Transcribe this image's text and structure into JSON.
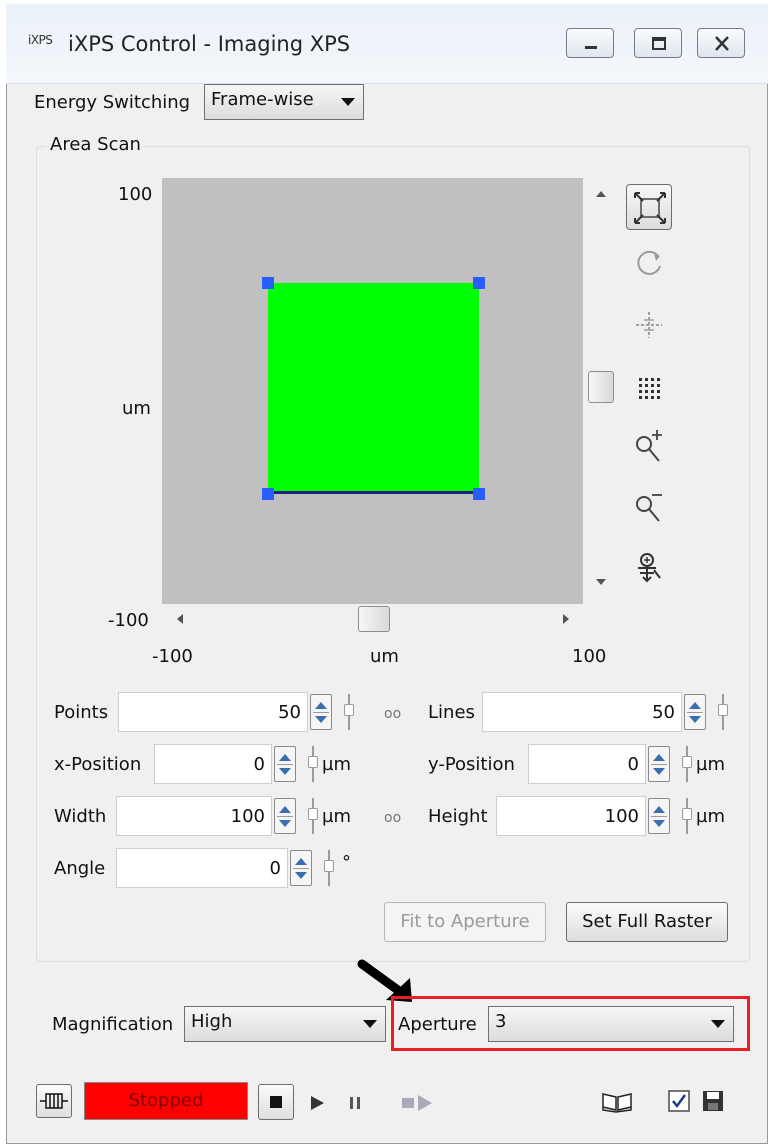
{
  "window": {
    "app_icon_text": "iXPS",
    "title": "iXPS Control - Imaging XPS",
    "controls": [
      "minimize-icon",
      "maximize-icon",
      "close-icon"
    ]
  },
  "energy_switching": {
    "label": "Energy Switching",
    "value": "Frame-wise"
  },
  "area_scan": {
    "group_label": "Area Scan",
    "plot": {
      "y_max": "100",
      "y_unit": "um",
      "y_min": "-100",
      "x_min": "-100",
      "x_unit": "um",
      "x_max": "100",
      "background_color": "#c0c0c0",
      "scan_area_color": "#00ff00",
      "handle_color": "#2b5cff"
    },
    "tools": [
      "fit-view-icon",
      "rotate-icon",
      "center-crosshair-icon",
      "grid-points-icon",
      "zoom-in-icon",
      "zoom-out-icon",
      "zoom-select-icon"
    ],
    "fields": {
      "points": {
        "label": "Points",
        "value": "50"
      },
      "lines": {
        "label": "Lines",
        "value": "50"
      },
      "x_position": {
        "label": "x-Position",
        "value": "0",
        "unit": "µm"
      },
      "y_position": {
        "label": "y-Position",
        "value": "0",
        "unit": "µm"
      },
      "width": {
        "label": "Width",
        "value": "100",
        "unit": "µm"
      },
      "height": {
        "label": "Height",
        "value": "100",
        "unit": "µm"
      },
      "angle": {
        "label": "Angle",
        "value": "0",
        "unit": "°"
      }
    },
    "link_symbol": "oo",
    "buttons": {
      "fit_to_aperture": "Fit to Aperture",
      "set_full_raster": "Set Full Raster"
    }
  },
  "magnification": {
    "label": "Magnification",
    "value": "High"
  },
  "aperture": {
    "label": "Aperture",
    "value": "3",
    "highlight_color": "#ee1c24"
  },
  "status": {
    "text": "Stopped",
    "color": "#ff0000"
  },
  "toolbar_icons": [
    "connect-icon",
    "stop-icon",
    "play-icon",
    "pause-icon",
    "step-forward-icon",
    "book-icon",
    "checkbox-icon",
    "save-icon"
  ]
}
